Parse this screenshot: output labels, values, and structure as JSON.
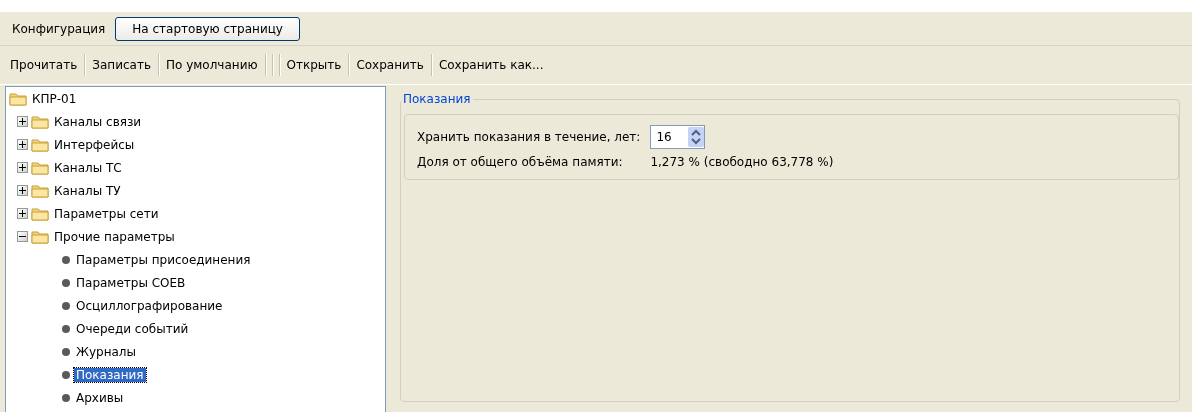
{
  "header": {
    "title": "Конфигурация",
    "home_button": "На стартовую страницу"
  },
  "toolbar": {
    "groups": [
      [
        "Прочитать",
        "Записать",
        "По умолчанию"
      ],
      [
        "Открыть",
        "Сохранить",
        "Сохранить как..."
      ]
    ]
  },
  "tree": [
    {
      "label": "КПР-01",
      "kind": "folder",
      "selected": false,
      "children": [
        {
          "label": "Каналы связи",
          "kind": "folder",
          "expanded": false,
          "selected": false
        },
        {
          "label": "Интерфейсы",
          "kind": "folder",
          "expanded": false,
          "selected": false
        },
        {
          "label": "Каналы ТС",
          "kind": "folder",
          "expanded": false,
          "selected": false
        },
        {
          "label": "Каналы ТУ",
          "kind": "folder",
          "expanded": false,
          "selected": false
        },
        {
          "label": "Параметры сети",
          "kind": "folder",
          "expanded": false,
          "selected": false
        },
        {
          "label": "Прочие параметры",
          "kind": "folder",
          "expanded": true,
          "selected": false,
          "children": [
            {
              "label": "Параметры присоединения",
              "kind": "leaf",
              "selected": false
            },
            {
              "label": "Параметры СОЕВ",
              "kind": "leaf",
              "selected": false
            },
            {
              "label": "Осциллографирование",
              "kind": "leaf",
              "selected": false
            },
            {
              "label": "Очереди событий",
              "kind": "leaf",
              "selected": false
            },
            {
              "label": "Журналы",
              "kind": "leaf",
              "selected": false
            },
            {
              "label": "Показания",
              "kind": "leaf",
              "selected": true
            },
            {
              "label": "Архивы",
              "kind": "leaf",
              "selected": false
            }
          ]
        }
      ]
    }
  ],
  "panel": {
    "title": "Показания",
    "keep_label": "Хранить показания в течение, лет:",
    "keep_value": "16",
    "share_label": "Доля от общего объёма памяти:",
    "share_value": "1,273 % (свободно 63,778 %)"
  }
}
